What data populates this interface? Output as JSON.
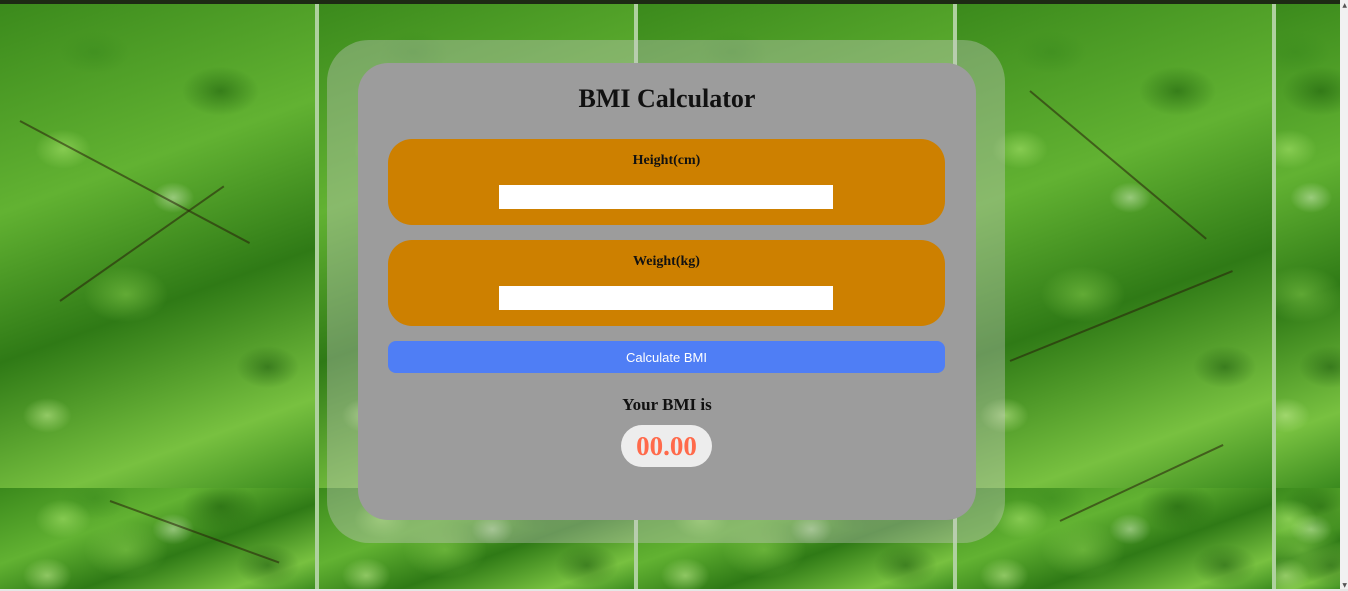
{
  "app": {
    "title": "BMI Calculator"
  },
  "form": {
    "height": {
      "label": "Height(cm)",
      "value": ""
    },
    "weight": {
      "label": "Weight(kg)",
      "value": ""
    },
    "calculate_label": "Calculate BMI"
  },
  "result": {
    "label": "Your BMI is",
    "value": "00.00"
  },
  "colors": {
    "card": "#9c9c9c",
    "field_box": "#cd8000",
    "button": "#4f7ef5",
    "result_text": "#ff6a4b"
  },
  "background": {
    "image": "green-leaves-background"
  }
}
